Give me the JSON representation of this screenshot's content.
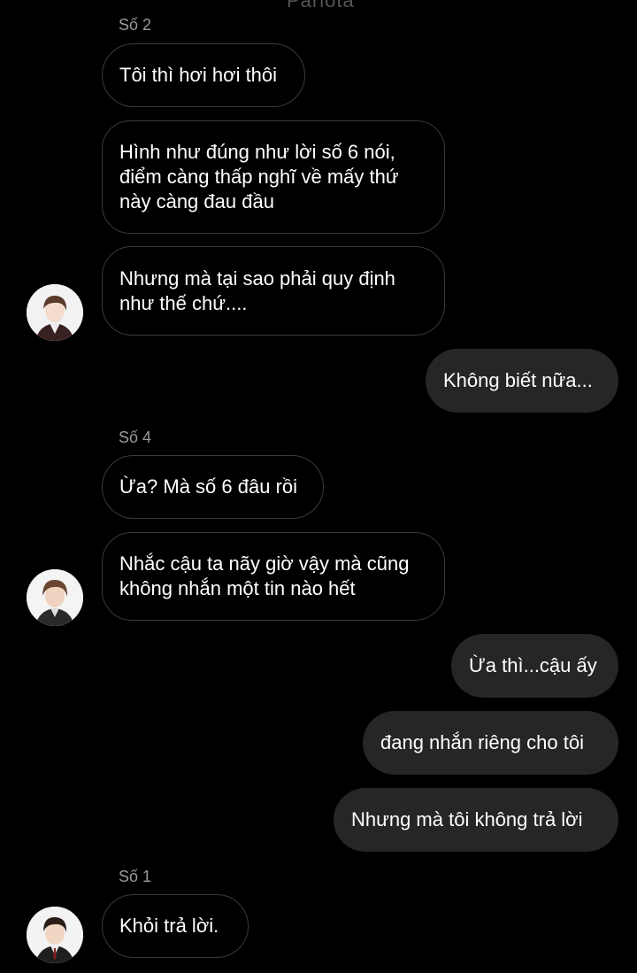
{
  "header": {
    "title_partial": "Pariota"
  },
  "messages": [
    {
      "id": "m1",
      "direction": "in",
      "sender": "Số 2",
      "text": "Tôi thì hơi hơi thôi"
    },
    {
      "id": "m2",
      "direction": "in",
      "text": "Hình như đúng như lời số 6 nói, điểm càng thấp nghĩ về mấy thứ này càng đau đầu"
    },
    {
      "id": "m3",
      "direction": "in",
      "text": "Nhưng mà tại sao phải quy định như thế chứ....",
      "avatar": "avatar-so-2"
    },
    {
      "id": "m4",
      "direction": "out",
      "text": "Không biết nữa..."
    },
    {
      "id": "m5",
      "direction": "in",
      "sender": "Số 4",
      "text": "Ừa? Mà số 6 đâu rồi"
    },
    {
      "id": "m6",
      "direction": "in",
      "text": "Nhắc cậu ta nãy giờ vậy mà cũng không nhắn một tin nào hết",
      "avatar": "avatar-so-4"
    },
    {
      "id": "m7",
      "direction": "out",
      "text": "Ừa thì...cậu ấy"
    },
    {
      "id": "m8",
      "direction": "out",
      "text": "đang nhắn riêng cho tôi"
    },
    {
      "id": "m9",
      "direction": "out",
      "text": "Nhưng mà tôi không trả lời"
    },
    {
      "id": "m10",
      "direction": "in",
      "sender": "Số 1",
      "text": "Khỏi trả lời.",
      "avatar": "avatar-so-1"
    }
  ],
  "colors": {
    "background": "#000000",
    "incoming_border": "#3a3a3a",
    "outgoing_bg": "#262626",
    "text": "#ffffff",
    "sender_label": "#9a9a9a"
  }
}
